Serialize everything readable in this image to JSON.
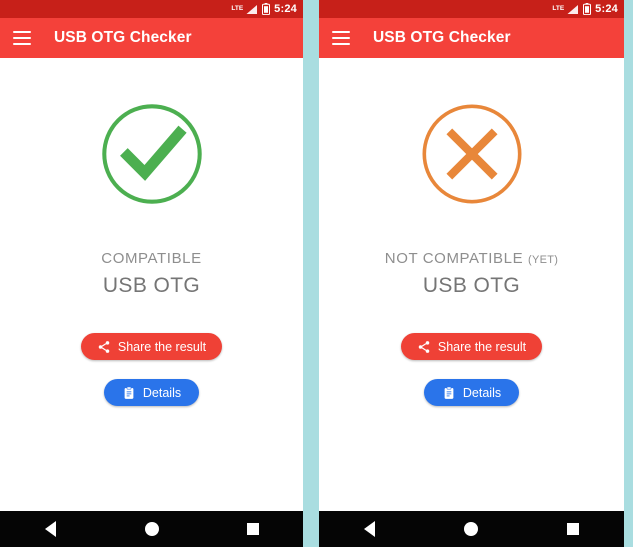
{
  "background_color": "#a9dde0",
  "theme": {
    "statusbar_color": "#c72019",
    "appbar_color": "#f4413a",
    "share_button_color": "#ef4136",
    "details_button_color": "#2a74ea",
    "compatible_icon_color": "#4caf50",
    "not_compatible_icon_color": "#e8873a",
    "result_text_color": "#8e8e8e",
    "navbar_color": "#050505"
  },
  "panels": [
    {
      "statusbar": {
        "time": "5:24",
        "signal_icon": "signal-bars-icon",
        "battery_icon": "battery-icon",
        "network_label": "LTE"
      },
      "appbar": {
        "menu_icon": "hamburger-menu-icon",
        "title": "USB OTG Checker"
      },
      "result": {
        "icon": "check-circle-icon",
        "icon_color": "#4caf50",
        "line1": "COMPATIBLE",
        "line1_suffix": "",
        "line2": "USB OTG"
      },
      "buttons": {
        "share_label": "Share the result",
        "share_icon": "share-icon",
        "details_label": "Details",
        "details_icon": "clipboard-icon"
      },
      "navbar": {
        "back_icon": "back-triangle-icon",
        "home_icon": "home-circle-icon",
        "recents_icon": "recents-square-icon"
      }
    },
    {
      "statusbar": {
        "time": "5:24",
        "signal_icon": "signal-bars-icon",
        "battery_icon": "battery-icon",
        "network_label": "LTE"
      },
      "appbar": {
        "menu_icon": "hamburger-menu-icon",
        "title": "USB OTG Checker"
      },
      "result": {
        "icon": "x-circle-icon",
        "icon_color": "#e8873a",
        "line1": "NOT COMPATIBLE",
        "line1_suffix": "(YET)",
        "line2": "USB OTG"
      },
      "buttons": {
        "share_label": "Share the result",
        "share_icon": "share-icon",
        "details_label": "Details",
        "details_icon": "clipboard-icon"
      },
      "navbar": {
        "back_icon": "back-triangle-icon",
        "home_icon": "home-circle-icon",
        "recents_icon": "recents-square-icon"
      }
    }
  ]
}
